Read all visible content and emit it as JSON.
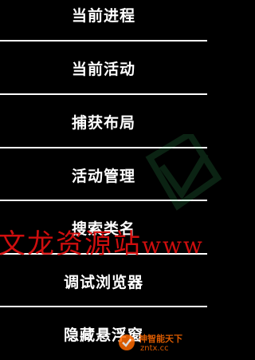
{
  "menu": {
    "items": [
      {
        "label": "当前进程"
      },
      {
        "label": "当前活动"
      },
      {
        "label": "捕获布局"
      },
      {
        "label": "活动管理"
      },
      {
        "label": "搜索类名"
      },
      {
        "label": "调试浏览器"
      },
      {
        "label": "隐藏悬浮窗"
      }
    ]
  },
  "watermark": {
    "main_cn": "文龙资源站",
    "main_latin": "www",
    "badge_line1": "神智能天下",
    "badge_line2": "zntx.cc",
    "color": "#e01010",
    "badge_color": "#ff6a00"
  },
  "colors": {
    "background": "#000000",
    "text": "#ffffff",
    "divider": "#ffffff"
  }
}
